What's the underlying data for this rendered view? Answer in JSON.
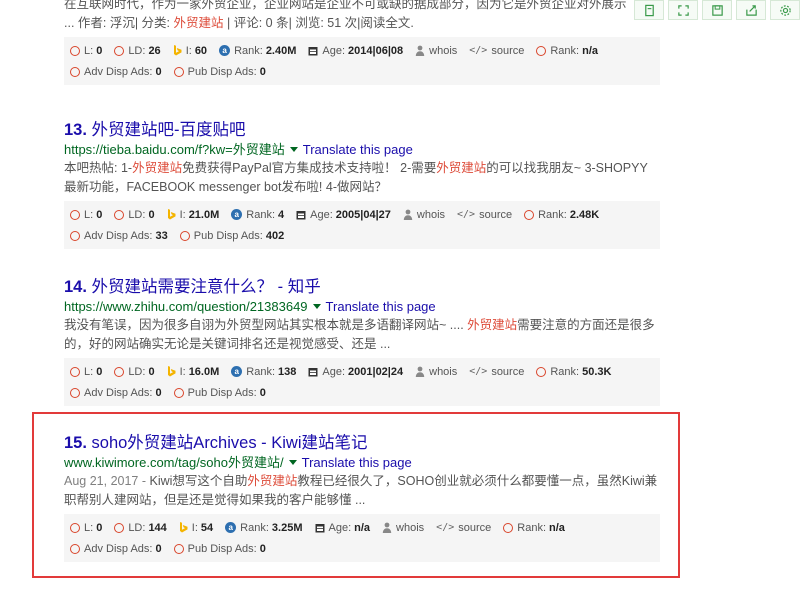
{
  "toolbar": [
    {
      "name": "copy-icon"
    },
    {
      "name": "expand-icon"
    },
    {
      "name": "save-icon"
    },
    {
      "name": "share-icon"
    },
    {
      "name": "settings-icon"
    }
  ],
  "top": {
    "desc_line1": "在互联网时代，作为一家外贸企业，企业网站是企业不可或缺的据成部分，因为它是外贸企业对外展示",
    "desc_prefix": "... 作者: 浮沉| 分类: ",
    "desc_hl": "外贸建站",
    "desc_suffix": " | 评论: 0 条| 浏览: 51 次|阅读全文.",
    "metrics": {
      "l": "0",
      "ld": "26",
      "i": "60",
      "rank": "2.40M",
      "age": "2014|06|08",
      "whois": "whois",
      "source": "source",
      "rank2": "n/a",
      "adv": "0",
      "pub": "0"
    }
  },
  "labels": {
    "l": "L:",
    "ld": "LD:",
    "i": "I:",
    "rank": "Rank:",
    "age": "Age:",
    "adv": "Adv Disp Ads:",
    "pub": "Pub Disp Ads:",
    "translate": "Translate this page"
  },
  "results": [
    {
      "num": "13.",
      "title": "外贸建站吧-百度贴吧",
      "url": "https://tieba.baidu.com/f?kw=外贸建站",
      "desc": [
        {
          "t": "本吧热帖: 1-"
        },
        {
          "t": "外贸建站",
          "hl": true
        },
        {
          "t": "免费获得PayPal官方集成技术支持啦！ 2-需要"
        },
        {
          "t": "外贸建站",
          "hl": true
        },
        {
          "t": "的可以找我朋友~ 3-SHOPYY最新功能，FACEBOOK messenger bot发布啦! 4-做网站？"
        }
      ],
      "metrics": {
        "l": "0",
        "ld": "0",
        "i": "21.0M",
        "rank": "4",
        "age": "2005|04|27",
        "whois": "whois",
        "source": "source",
        "rank2": "2.48K",
        "adv": "33",
        "pub": "402"
      }
    },
    {
      "num": "14.",
      "title": "外贸建站需要注意什么？ - 知乎",
      "url": "https://www.zhihu.com/question/21383649",
      "desc": [
        {
          "t": "我没有笔误，因为很多自诩为外贸型网站其实根本就是多语翻译网站~ .... "
        },
        {
          "t": "外贸建站",
          "hl": true
        },
        {
          "t": "需要注意的方面还是很多的，好的网站确实无论是关键词排名还是视觉感受、还是 ..."
        }
      ],
      "metrics": {
        "l": "0",
        "ld": "0",
        "i": "16.0M",
        "rank": "138",
        "age": "2001|02|24",
        "whois": "whois",
        "source": "source",
        "rank2": "50.3K",
        "adv": "0",
        "pub": "0"
      }
    },
    {
      "num": "15.",
      "title": "soho外贸建站Archives - Kiwi建站笔记",
      "url": "www.kiwimore.com/tag/soho外贸建站/",
      "desc": [
        {
          "t": "Aug 21, 2017 - ",
          "date": true
        },
        {
          "t": "Kiwi想写这个自助"
        },
        {
          "t": "外贸建站",
          "hl": true
        },
        {
          "t": "教程已经很久了，SOHO创业就必须什么都要懂一点，虽然Kiwi兼职帮别人建网站，但是还是觉得如果我的客户能够懂 ..."
        }
      ],
      "metrics": {
        "l": "0",
        "ld": "144",
        "i": "54",
        "rank": "3.25M",
        "age": "n/a",
        "whois": "whois",
        "source": "source",
        "rank2": "n/a",
        "adv": "0",
        "pub": "0"
      }
    }
  ],
  "colors": {
    "title": "#1a0dab",
    "url": "#006621",
    "highlight": "#dd4b39",
    "box": "#e23a3a"
  }
}
